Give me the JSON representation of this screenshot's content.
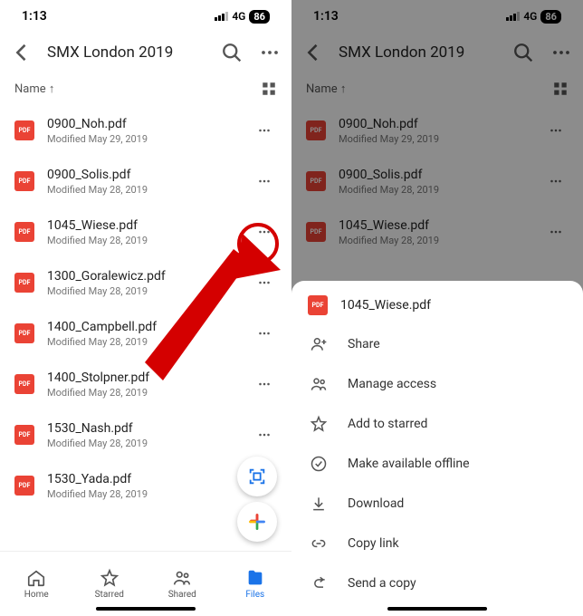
{
  "status": {
    "time": "1:13",
    "net": "4G",
    "battery": "86"
  },
  "header": {
    "title": "SMX London 2019"
  },
  "sort": {
    "label": "Name",
    "dir": "↑"
  },
  "files": [
    {
      "name": "0900_Noh.pdf",
      "modified": "Modified May 29, 2019"
    },
    {
      "name": "0900_Solis.pdf",
      "modified": "Modified May 28, 2019"
    },
    {
      "name": "1045_Wiese.pdf",
      "modified": "Modified May 28, 2019"
    },
    {
      "name": "1300_Goralewicz.pdf",
      "modified": "Modified May 28, 2019"
    },
    {
      "name": "1400_Campbell.pdf",
      "modified": "Modified May 28, 2019"
    },
    {
      "name": "1400_Stolpner.pdf",
      "modified": "Modified May 28, 2019"
    },
    {
      "name": "1530_Nash.pdf",
      "modified": "Modified May 28, 2019"
    },
    {
      "name": "1530_Yada.pdf",
      "modified": "Modified May 28, 2019"
    }
  ],
  "tabs": [
    {
      "label": "Home",
      "active": false
    },
    {
      "label": "Starred",
      "active": false
    },
    {
      "label": "Shared",
      "active": false
    },
    {
      "label": "Files",
      "active": true
    }
  ],
  "sheet": {
    "file": "1045_Wiese.pdf",
    "items": [
      {
        "label": "Share",
        "icon": "person-add"
      },
      {
        "label": "Manage access",
        "icon": "people"
      },
      {
        "label": "Add to starred",
        "icon": "star"
      },
      {
        "label": "Make available offline",
        "icon": "offline"
      },
      {
        "label": "Download",
        "icon": "download"
      },
      {
        "label": "Copy link",
        "icon": "link"
      },
      {
        "label": "Send a copy",
        "icon": "send"
      }
    ]
  },
  "colors": {
    "accent": "#1a73e8",
    "pdf": "#ea4335",
    "arrow": "#d40000"
  }
}
